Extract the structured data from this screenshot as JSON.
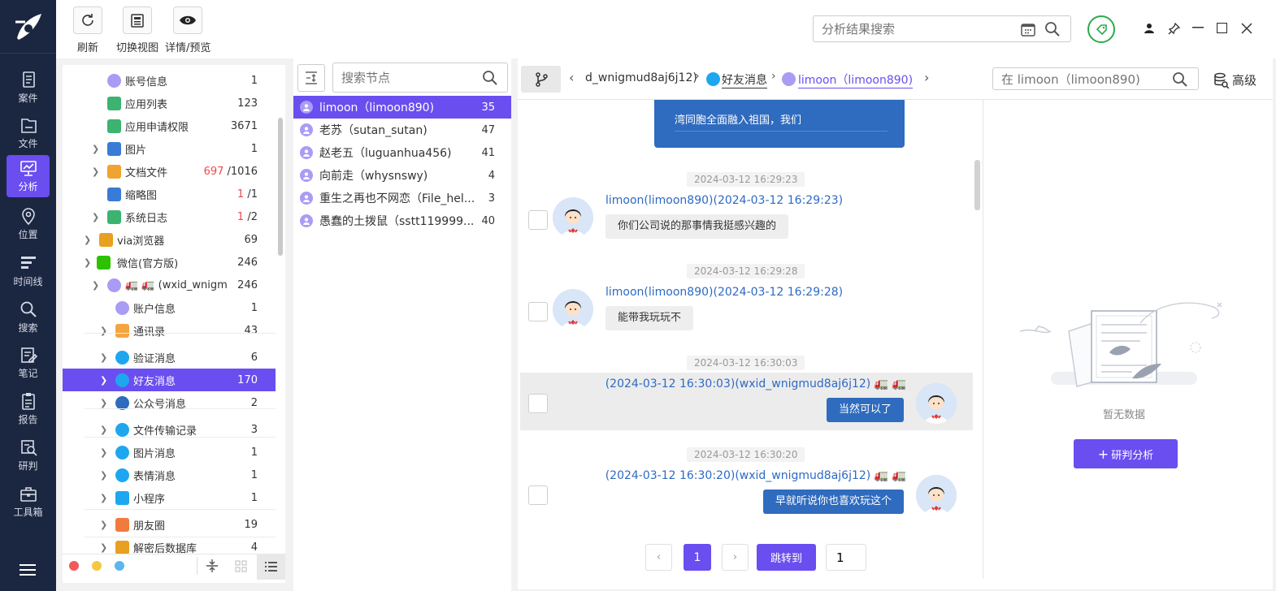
{
  "toolbar": {
    "refresh": "刷新",
    "switch_view": "切换视图",
    "details": "详情/预览"
  },
  "search": {
    "placeholder": "分析结果搜索"
  },
  "nav": [
    {
      "label": "案件",
      "icon": "case-icon"
    },
    {
      "label": "文件",
      "icon": "folder-icon"
    },
    {
      "label": "分析",
      "icon": "analysis-icon"
    },
    {
      "label": "位置",
      "icon": "location-icon"
    },
    {
      "label": "时间线",
      "icon": "timeline-icon"
    },
    {
      "label": "搜索",
      "icon": "search-icon"
    },
    {
      "label": "笔记",
      "icon": "note-icon"
    },
    {
      "label": "报告",
      "icon": "report-icon"
    },
    {
      "label": "研判",
      "icon": "judge-icon"
    },
    {
      "label": "工具箱",
      "icon": "toolbox-icon"
    }
  ],
  "tree": [
    {
      "label": "账号信息",
      "count": "1"
    },
    {
      "label": "应用列表",
      "count": "123"
    },
    {
      "label": "应用申请权限",
      "count": "3671"
    },
    {
      "label": "图片",
      "count": "1"
    },
    {
      "label": "文档文件",
      "count_red": "697",
      "count": "/1016"
    },
    {
      "label": "缩略图",
      "count_red": "1",
      "count": "/1"
    },
    {
      "label": "系统日志",
      "count_red": "1",
      "count": "/2"
    },
    {
      "label": "via浏览器",
      "count": "69"
    },
    {
      "label": "微信(官方版)",
      "count": "246"
    },
    {
      "label": "🚛 🚛 (wxid_wnigm...",
      "count": "246"
    },
    {
      "label": "账户信息",
      "count": "1"
    },
    {
      "label": "通讯录",
      "count": "43"
    },
    {
      "label": "验证消息",
      "count": "6"
    },
    {
      "label": "好友消息",
      "count": "170"
    },
    {
      "label": "公众号消息",
      "count": "2"
    },
    {
      "label": "文件传输记录",
      "count": "3"
    },
    {
      "label": "图片消息",
      "count": "1"
    },
    {
      "label": "表情消息",
      "count": "1"
    },
    {
      "label": "小程序",
      "count": "1"
    },
    {
      "label": "朋友圈",
      "count": "19"
    },
    {
      "label": "解密后数据库",
      "count": "4"
    }
  ],
  "node_search": {
    "placeholder": "搜索节点"
  },
  "contacts": [
    {
      "name": "limoon（limoon890)",
      "count": "35"
    },
    {
      "name": "老苏（sutan_sutan)",
      "count": "47"
    },
    {
      "name": "赵老五（luguanhua456)",
      "count": "41"
    },
    {
      "name": "向前走（whysnswy)",
      "count": "4"
    },
    {
      "name": "重生之再也不网恋（File_hel...",
      "count": "3"
    },
    {
      "name": "愚蠢的土拨鼠（sstt119999...",
      "count": "40"
    }
  ],
  "breadcrumb": {
    "b1": "d_wnigmud8aj6j12)",
    "b2": "好友消息",
    "b3": "limoon（limoon890)"
  },
  "chat_search": {
    "placeholder": "在 limoon（limoon890)"
  },
  "advanced": "高级",
  "chat": {
    "top_bubble": "湾同胞全面融入祖国，我们",
    "messages": [
      {
        "time": "2024-03-12 16:29:23",
        "sender": "limoon(limoon890)(2024-03-12 16:29:23)",
        "text": "你们公司说的那事情我挺感兴趣的",
        "side": "left"
      },
      {
        "time": "2024-03-12 16:29:28",
        "sender": "limoon(limoon890)(2024-03-12 16:29:28)",
        "text": "能带我玩玩不",
        "side": "left"
      },
      {
        "time": "2024-03-12 16:30:03",
        "sender": "(2024-03-12 16:30:03)(wxid_wnigmud8aj6j12) 🚛 🚛",
        "text": "当然可以了",
        "side": "right"
      },
      {
        "time": "2024-03-12 16:30:20",
        "sender": "(2024-03-12 16:30:20)(wxid_wnigmud8aj6j12) 🚛 🚛",
        "text": "早就听说你也喜欢玩这个",
        "side": "right"
      }
    ]
  },
  "pagination": {
    "current": "1",
    "jump_label": "跳转到",
    "jump_value": "1"
  },
  "empty": {
    "text": "暂无数据",
    "button": "研判分析"
  },
  "colors": {
    "accent": "#6a4ef0",
    "nav_bg": "#1b2640",
    "bubble_blue": "#2f6bbf"
  }
}
